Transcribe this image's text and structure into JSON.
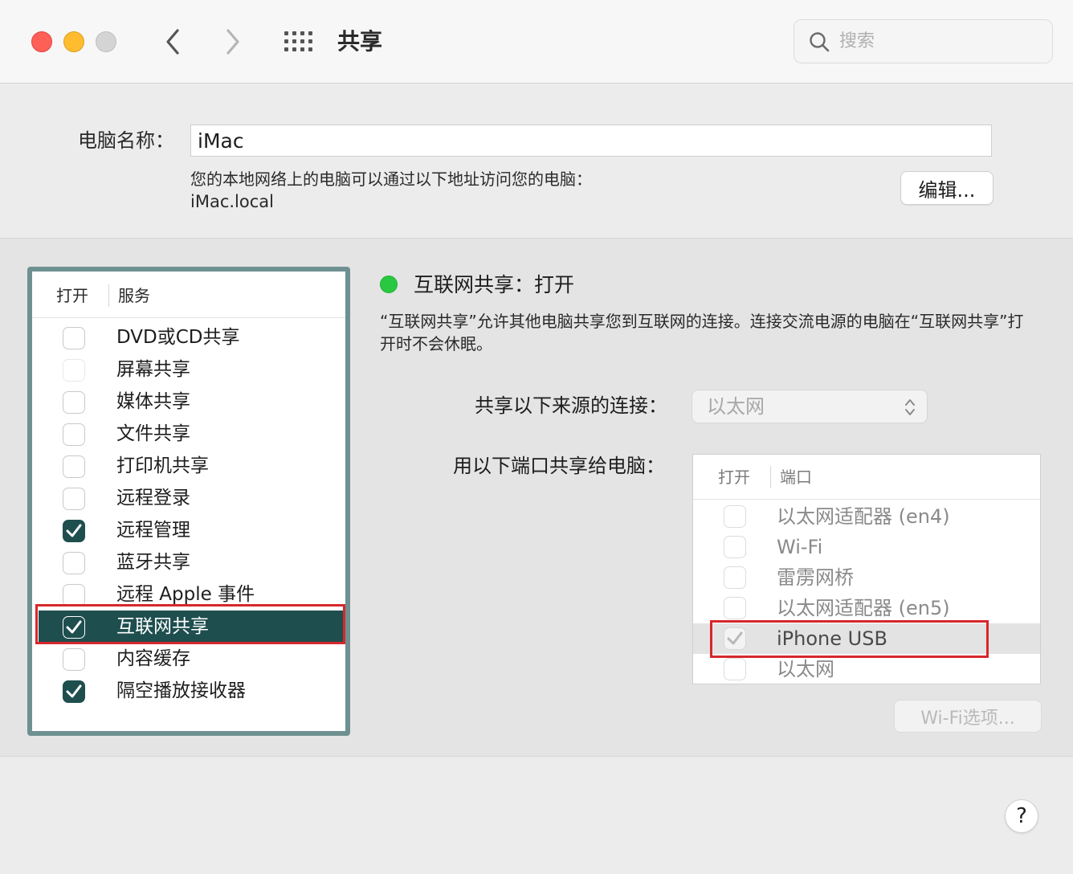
{
  "window": {
    "title": "共享",
    "search_placeholder": "搜索"
  },
  "computer_name": {
    "label": "电脑名称：",
    "value": "iMac",
    "address_description": "您的本地网络上的电脑可以通过以下地址访问您的电脑：",
    "address": "iMac.local",
    "edit_button": "编辑..."
  },
  "services": {
    "header_on": "打开",
    "header_service": "服务",
    "items": [
      {
        "label": "DVD或CD共享",
        "checked": false
      },
      {
        "label": "屏幕共享",
        "checked": false
      },
      {
        "label": "媒体共享",
        "checked": false
      },
      {
        "label": "文件共享",
        "checked": false
      },
      {
        "label": "打印机共享",
        "checked": false
      },
      {
        "label": "远程登录",
        "checked": false
      },
      {
        "label": "远程管理",
        "checked": true
      },
      {
        "label": "蓝牙共享",
        "checked": false
      },
      {
        "label": "远程 Apple 事件",
        "checked": false
      },
      {
        "label": "互联网共享",
        "checked": true,
        "selected": true
      },
      {
        "label": "内容缓存",
        "checked": false
      },
      {
        "label": "隔空播放接收器",
        "checked": true
      }
    ]
  },
  "detail": {
    "status_title": "互联网共享：打开",
    "status_color": "#28c840",
    "description": "“互联网共享”允许其他电脑共享您到互联网的连接。连接交流电源的电脑在“互联网共享”打开时不会休眠。",
    "source_label": "共享以下来源的连接：",
    "source_value": "以太网",
    "ports_label": "用以下端口共享给电脑：",
    "ports_header_on": "打开",
    "ports_header_port": "端口",
    "ports": [
      {
        "label": "以太网适配器 (en4)",
        "checked": false
      },
      {
        "label": "Wi-Fi",
        "checked": false
      },
      {
        "label": "雷雳网桥",
        "checked": false
      },
      {
        "label": "以太网适配器 (en5)",
        "checked": false
      },
      {
        "label": "iPhone USB",
        "checked": true,
        "highlighted": true
      },
      {
        "label": "以太网",
        "checked": false
      }
    ],
    "wifi_options_button": "Wi-Fi选项..."
  },
  "help_button": "?",
  "accent_color": "#1f4e4f",
  "highlight_box_color": "#d6282c"
}
